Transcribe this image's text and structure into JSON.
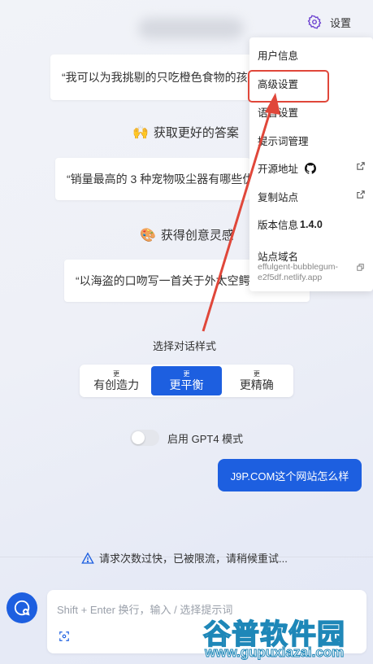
{
  "header": {
    "settings_label": "设置"
  },
  "examples": {
    "card1": "“我可以为我挑剔的只吃橙色食物的孩子做什么饭",
    "section2_title": "获取更好的答案",
    "section2_emoji": "🙌",
    "card2": "“销量最高的 3 种宠物吸尘器有哪些优",
    "section3_title": "获得创意灵感",
    "section3_emoji": "🎨",
    "card3": "“以海盗的口吻写一首关于外太空鳄鱼的诗"
  },
  "style_selector": {
    "label": "选择对话样式",
    "options": [
      {
        "small": "更",
        "big": "有创造力",
        "active": false
      },
      {
        "small": "更",
        "big": "更平衡",
        "active": true
      },
      {
        "small": "更",
        "big": "更精确",
        "active": false
      }
    ]
  },
  "gpt4": {
    "label": "启用 GPT4 模式",
    "enabled": false
  },
  "chat": {
    "user_message": "J9P.COM这个网站怎么样"
  },
  "warning": {
    "text": "请求次数过快，已被限流，请稍候重试..."
  },
  "input": {
    "placeholder": "Shift + Enter 换行，输入 / 选择提示词"
  },
  "menu": {
    "items": [
      "用户信息",
      "高级设置",
      "语音设置",
      "提示词管理",
      "开源地址",
      "复制站点",
      "版本信息"
    ],
    "version": "1.4.0",
    "domain_label": "站点域名",
    "domain_value": "effulgent-bubblegum-e2f5df.netlify.app"
  },
  "watermark": {
    "cn": "谷普软件园",
    "url": "www.gupuxiazai.com"
  },
  "colors": {
    "accent": "#1d5fe0",
    "annotation": "#e0473a"
  }
}
